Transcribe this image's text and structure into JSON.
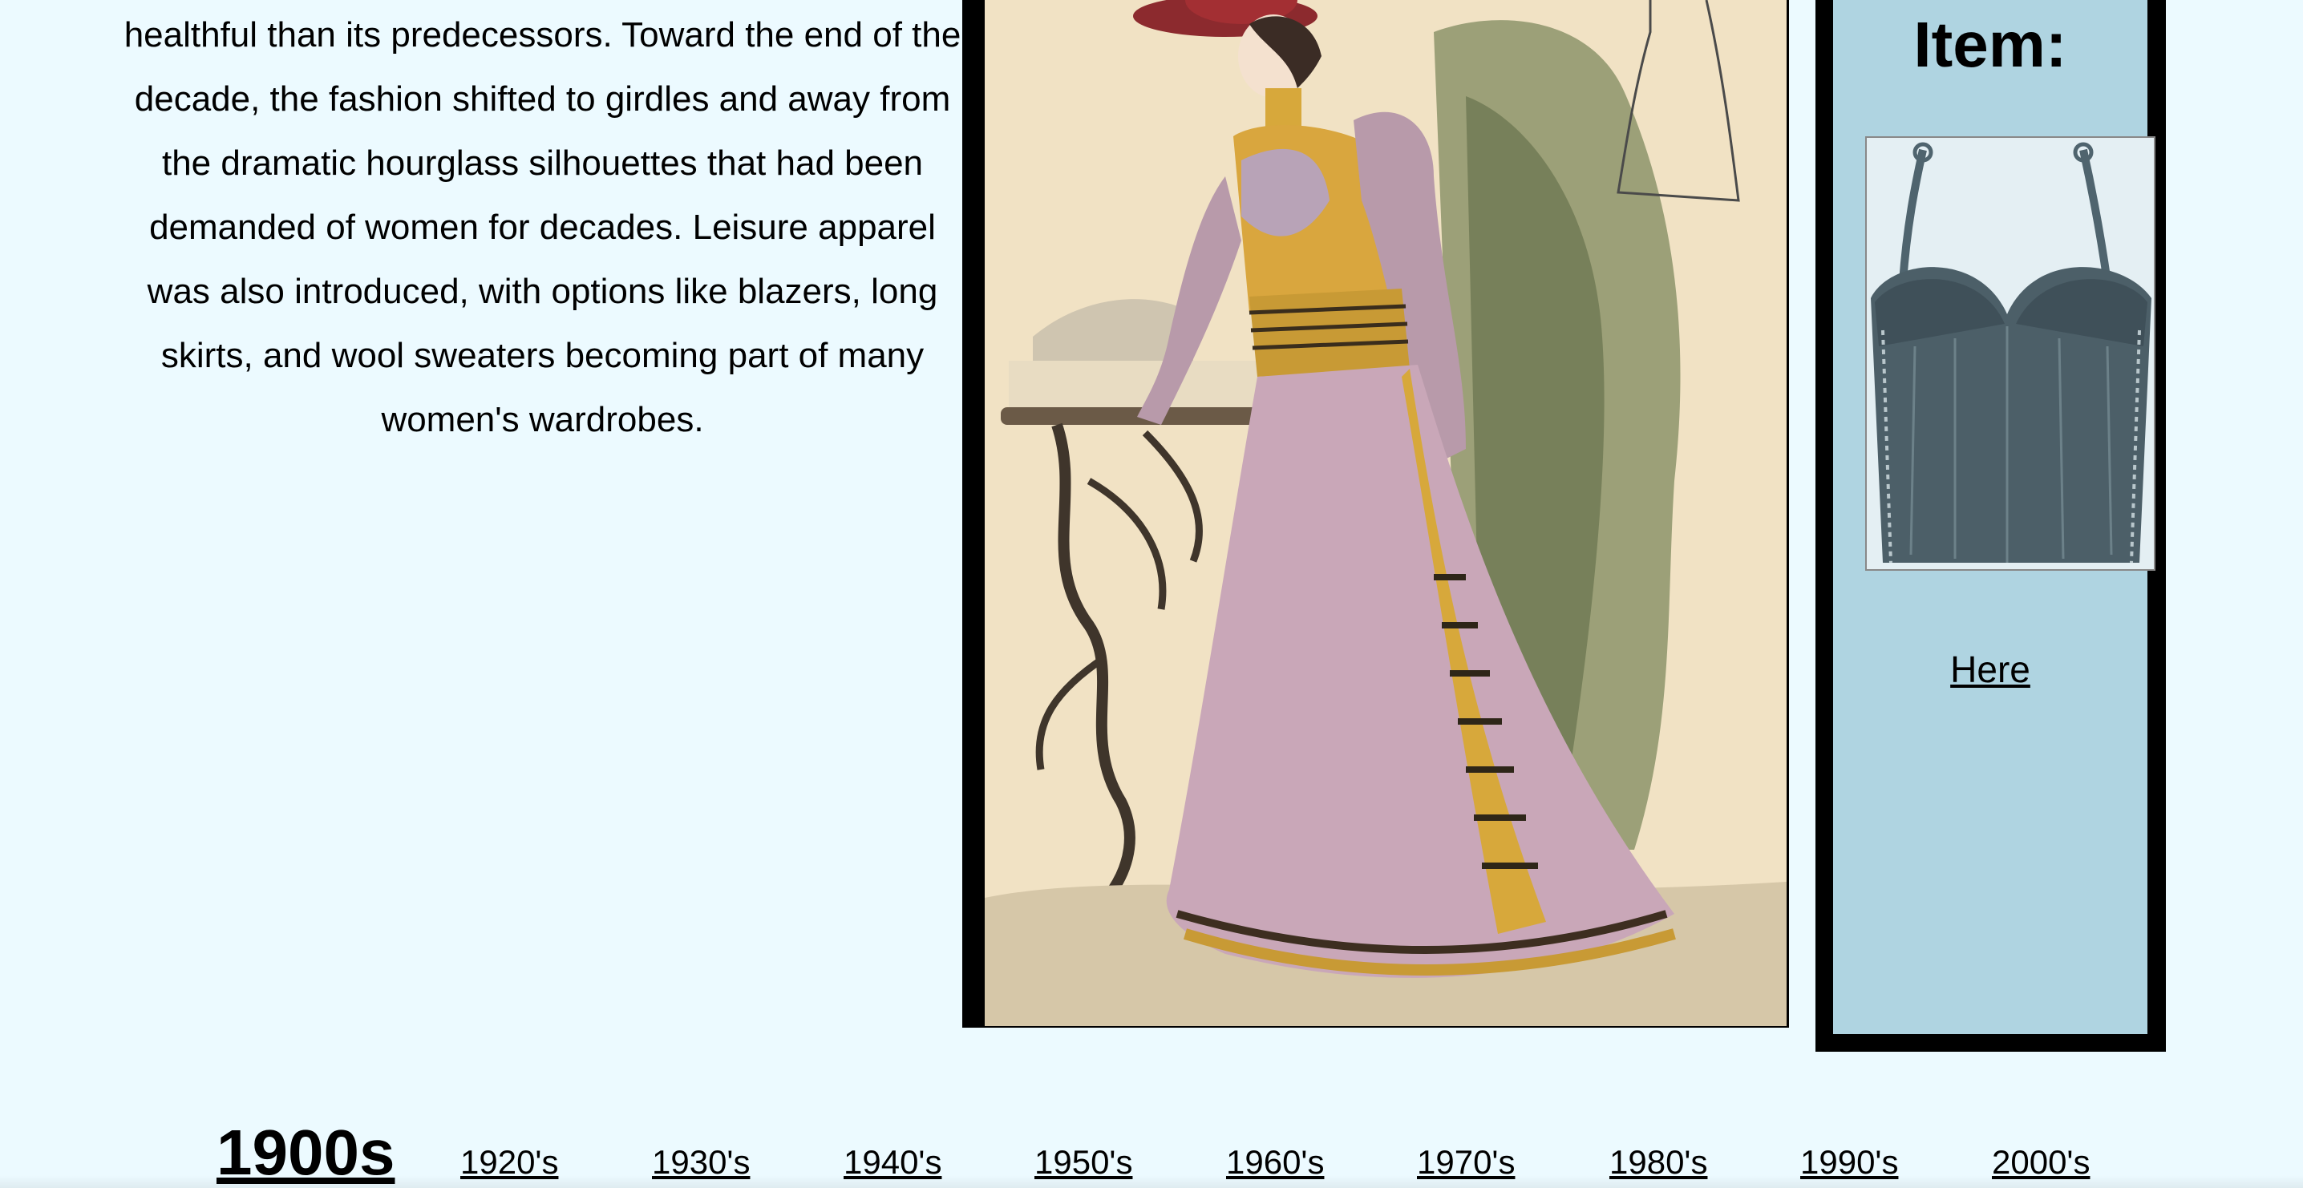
{
  "description": {
    "text": "healthful than its predecessors. Toward the end of the decade, the fashion shifted to girdles and away from the dramatic hourglass silhouettes that had been demanded of women for decades. Leisure apparel was also introduced, with options like blazers, long skirts, and wool sweaters becoming part of many women's wardrobes."
  },
  "item": {
    "title": "Item:",
    "link_label": "Here"
  },
  "decades": {
    "current": "1900s",
    "links": [
      "1920's",
      "1930's",
      "1940's",
      "1950's",
      "1960's",
      "1970's",
      "1980's",
      "1990's",
      "2000's"
    ]
  },
  "colors": {
    "page_background": "#ecfaff",
    "item_panel": "#afd4e1",
    "frame": "#000000"
  }
}
